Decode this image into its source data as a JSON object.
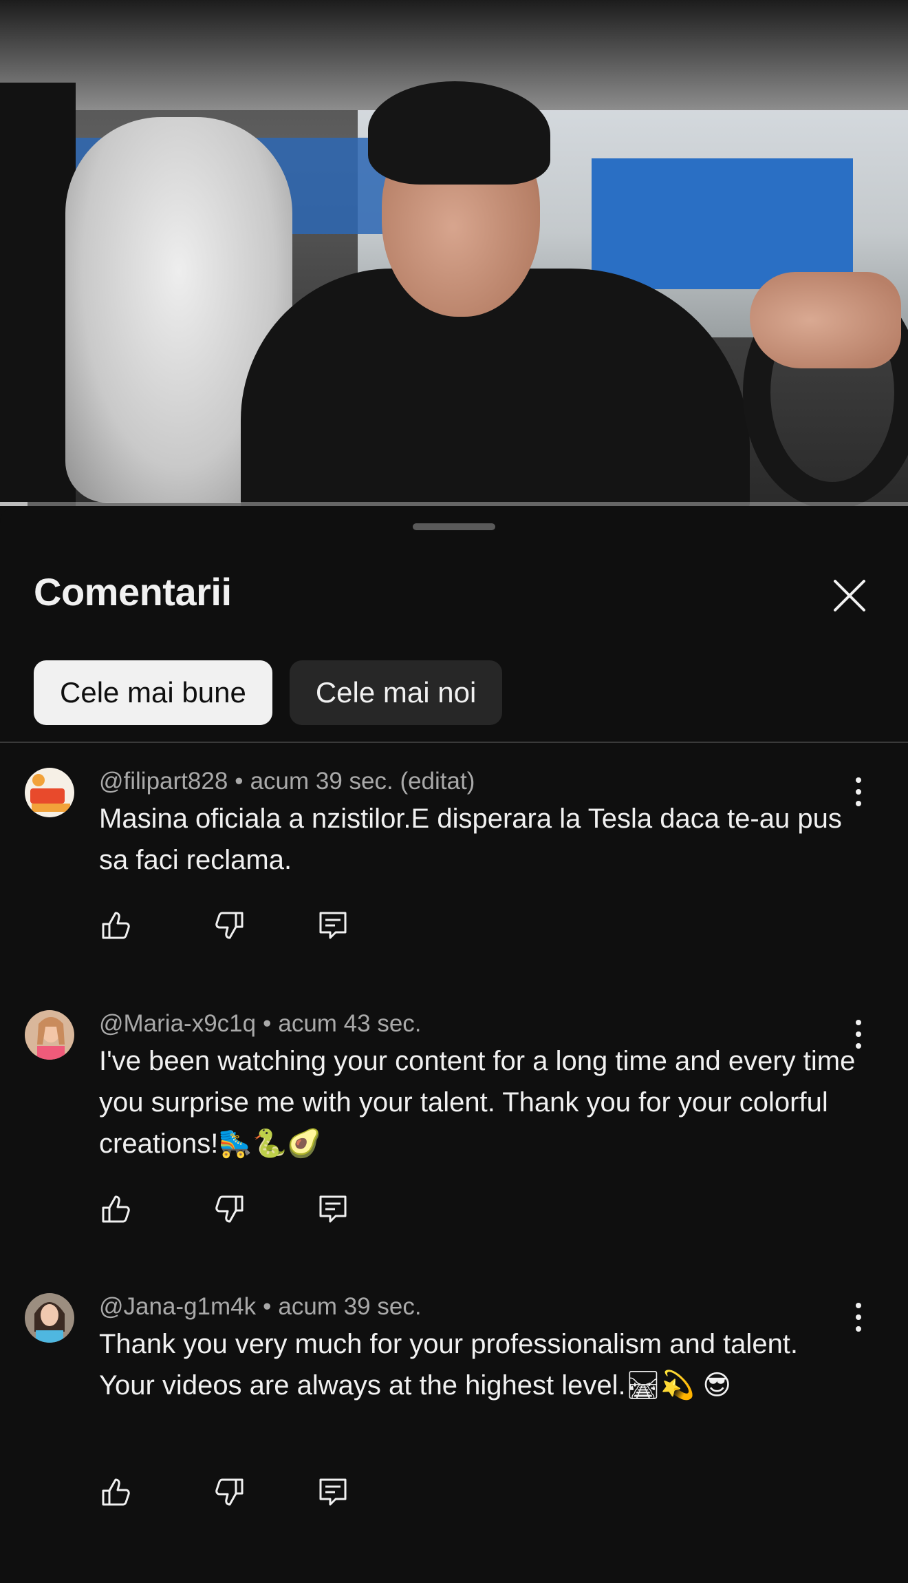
{
  "video": {
    "progress_fraction": 0.03
  },
  "sheet": {
    "title": "Comentarii",
    "close_icon": "close-icon"
  },
  "sort_chips": [
    {
      "label": "Cele mai bune",
      "selected": true
    },
    {
      "label": "Cele mai noi",
      "selected": false
    }
  ],
  "comments": [
    {
      "author": "@filipart828",
      "separator": "•",
      "time": "acum 39 sec. (editat)",
      "text": "Masina oficiala a nzistilor.E disperara la Tesla daca te-au pus sa faci reclama.",
      "avatar_colors": [
        "#f6f0e6",
        "#e84a2c",
        "#f2a23a"
      ]
    },
    {
      "author": "@Maria-x9c1q",
      "separator": "•",
      "time": "acum 43 sec.",
      "text": "I've been watching your content for a long time and every time you surprise me with your talent. Thank you for your colorful creations!🛼🐍🥑",
      "avatar_colors": [
        "#f3c6a8",
        "#d88a72",
        "#ef5b7a"
      ]
    },
    {
      "author": "@Jana-g1m4k",
      "separator": "•",
      "time": "acum 39 sec.",
      "text": "Thank you very much for your professionalism and talent. Your videos are always at the highest level.🛤💫 😎",
      "avatar_colors": [
        "#f0c9b0",
        "#3b2a22",
        "#4fb7e0"
      ]
    }
  ],
  "icons": {
    "like": "thumbs-up-icon",
    "dislike": "thumbs-down-icon",
    "reply": "reply-icon",
    "more": "more-vertical-icon"
  },
  "colors": {
    "background": "#0f0f0f",
    "text_primary": "#f1f1f1",
    "text_secondary": "#a9a9a9",
    "chip_active_bg": "#f1f1f1",
    "chip_inactive_bg": "#272727"
  }
}
